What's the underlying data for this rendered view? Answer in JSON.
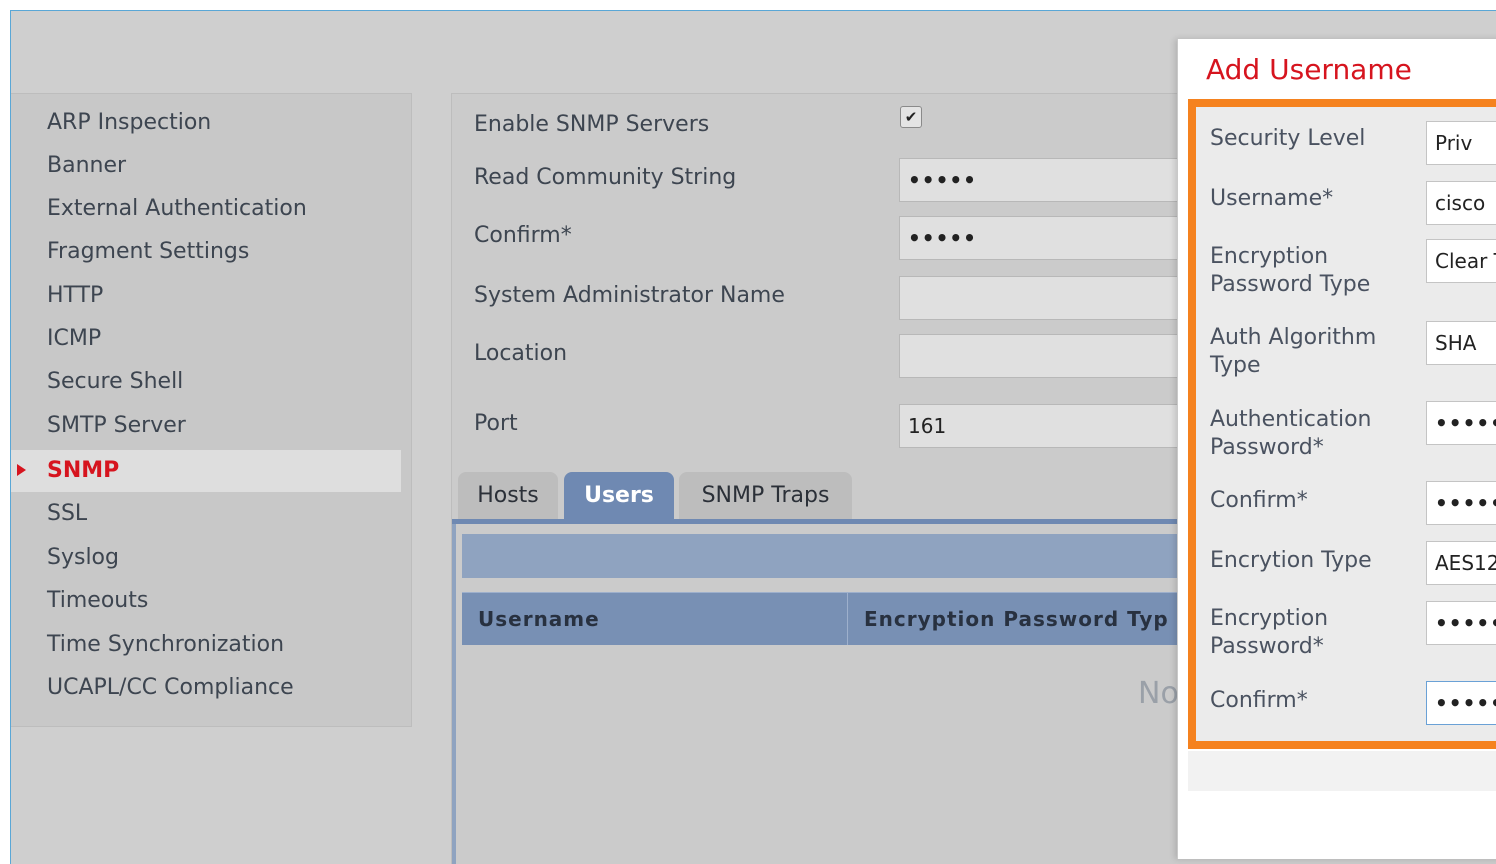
{
  "sidebar": {
    "items": [
      {
        "label": "ARP Inspection"
      },
      {
        "label": "Banner"
      },
      {
        "label": "External Authentication"
      },
      {
        "label": "Fragment Settings"
      },
      {
        "label": "HTTP"
      },
      {
        "label": "ICMP"
      },
      {
        "label": "Secure Shell"
      },
      {
        "label": "SMTP Server"
      },
      {
        "label": "SNMP"
      },
      {
        "label": "SSL"
      },
      {
        "label": "Syslog"
      },
      {
        "label": "Timeouts"
      },
      {
        "label": "Time Synchronization"
      },
      {
        "label": "UCAPL/CC Compliance"
      }
    ],
    "active": "SNMP"
  },
  "form": {
    "enable_label": "Enable SNMP Servers",
    "enable_checked": "✔",
    "read_community_label": "Read Community String",
    "read_community_value": "•••••",
    "confirm_label": "Confirm*",
    "confirm_value": "•••••",
    "sysadmin_label": "System Administrator Name",
    "sysadmin_value": "",
    "location_label": "Location",
    "location_value": "",
    "port_label": "Port",
    "port_value": "161"
  },
  "tabs": [
    {
      "label": "Hosts"
    },
    {
      "label": "Users"
    },
    {
      "label": "SNMP Traps"
    }
  ],
  "users_table": {
    "columns": [
      "Username",
      "Encryption Password Typ"
    ],
    "empty_text": "No"
  },
  "dialog": {
    "title": "Add Username",
    "fields": {
      "security_level": {
        "label": "Security Level",
        "value": "Priv"
      },
      "username": {
        "label": "Username*",
        "value": "cisco"
      },
      "enc_pw_type": {
        "label": "Encryption Password Type",
        "value": "Clear T"
      },
      "auth_algo": {
        "label": "Auth Algorithm Type",
        "value": "SHA"
      },
      "auth_pw": {
        "label": "Authentication Password*",
        "value": "•••••••"
      },
      "auth_confirm": {
        "label": "Confirm*",
        "value": "•••••••"
      },
      "enc_type": {
        "label": "Encrytion Type",
        "value": "AES12"
      },
      "enc_pw": {
        "label": "Encryption Password*",
        "value": "•••••••"
      },
      "enc_confirm": {
        "label": "Confirm*",
        "value": "•••••••"
      }
    }
  },
  "colors": {
    "accent_red": "#d6141e",
    "highlight_orange": "#f5821f",
    "tab_active": "#6f89b2"
  }
}
